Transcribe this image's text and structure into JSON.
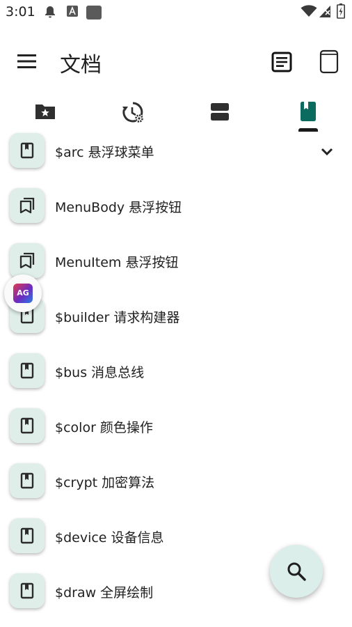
{
  "status_bar": {
    "time": "3:01",
    "left_icons": [
      "notification-bell-icon",
      "font-a-icon",
      "square-icon"
    ],
    "right_icons": [
      "wifi-icon",
      "signal-icon",
      "battery-icon"
    ]
  },
  "app_bar": {
    "title": "文档",
    "menu_icon": "hamburger-menu-icon",
    "action_icons": [
      "document-list-icon",
      "tablet-icon"
    ]
  },
  "tabs": [
    {
      "icon": "folder-star-icon",
      "selected": false
    },
    {
      "icon": "history-settings-icon",
      "selected": false
    },
    {
      "icon": "view-agenda-icon",
      "selected": false
    },
    {
      "icon": "book-icon",
      "selected": true
    }
  ],
  "items": [
    {
      "label": "$arc 悬浮球菜单",
      "icon": "bookmark-icon",
      "expandable": true
    },
    {
      "label": "MenuBody 悬浮按钮",
      "icon": "bookmarks-icon"
    },
    {
      "label": "MenuItem 悬浮按钮",
      "icon": "bookmarks-icon"
    },
    {
      "label": "$builder 请求构建器",
      "icon": "bookmark-icon"
    },
    {
      "label": "$bus 消息总线",
      "icon": "bookmark-icon"
    },
    {
      "label": "$color 颜色操作",
      "icon": "bookmark-icon"
    },
    {
      "label": "$crypt 加密算法",
      "icon": "bookmark-icon"
    },
    {
      "label": "$device 设备信息",
      "icon": "bookmark-icon"
    },
    {
      "label": "$draw 全屏绘制",
      "icon": "bookmark-icon"
    }
  ],
  "floating_badge": {
    "text": "AG"
  },
  "fab": {
    "icon": "search-icon"
  },
  "colors": {
    "accent": "#0b6b5e",
    "icon_box": "#dfeee9",
    "fab": "#dceee9"
  }
}
